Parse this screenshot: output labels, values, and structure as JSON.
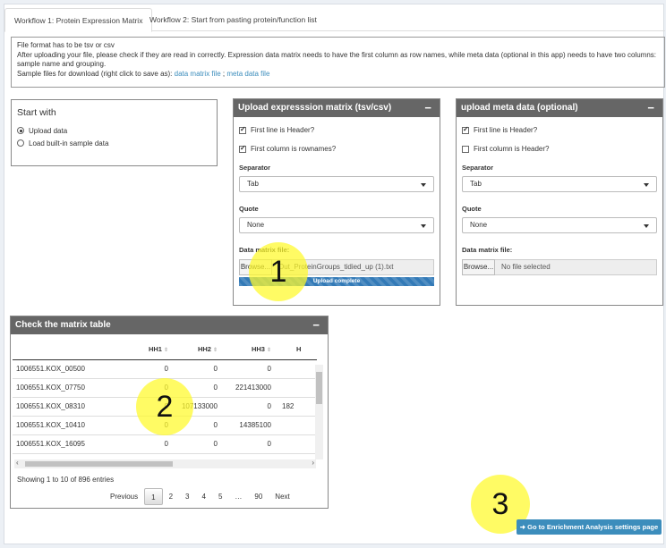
{
  "tabs": [
    "Workflow 1: Protein Expression Matrix",
    "Workflow 2: Start from pasting protein/function list"
  ],
  "info": {
    "line1": "File format has to be tsv or csv",
    "line2": "After uploading your file, please check if they are read in correctly. Expression data matrix needs to have the first column as row names, while meta data (optional in this app) needs to have two columns:",
    "line3": "sample name and grouping.",
    "line4": "Sample files for download (right click to save as):",
    "link1": "data matrix file",
    "sep": ";",
    "link2": "meta data file"
  },
  "start_with": {
    "title": "Start with",
    "options": [
      "Upload data",
      "Load built-in sample data"
    ],
    "selected": 0
  },
  "upload_matrix": {
    "title": "Upload expresssion matrix (tsv/csv)",
    "collapse": "−",
    "first_line_header": {
      "label": "First line is Header?",
      "checked": true
    },
    "first_col_rownames": {
      "label": "First column is rownames?",
      "checked": true
    },
    "separator_label": "Separator",
    "separator_value": "Tab",
    "quote_label": "Quote",
    "quote_value": "None",
    "file_label": "Data matrix file:",
    "browse": "Browse...",
    "file_name": "Out_ProteinGroups_tidied_up (1).txt",
    "progress": "Upload complete",
    "progress_fraction": 1.0
  },
  "upload_meta": {
    "title": "upload meta data (optional)",
    "collapse": "−",
    "first_line_header": {
      "label": "First line is Header?",
      "checked": true
    },
    "first_col_header": {
      "label": "First column is Header?",
      "checked": false
    },
    "separator_label": "Separator",
    "separator_value": "Tab",
    "quote_label": "Quote",
    "quote_value": "None",
    "file_label": "Data matrix file:",
    "browse": "Browse...",
    "file_name": "No file selected"
  },
  "matrix": {
    "title": "Check the matrix table",
    "collapse": "−",
    "columns": [
      "",
      "HH1",
      "HH2",
      "HH3",
      "H"
    ],
    "rows": [
      [
        "1006551.KOX_00500",
        "0",
        "0",
        "0",
        ""
      ],
      [
        "1006551.KOX_07750",
        "0",
        "0",
        "221413000",
        ""
      ],
      [
        "1006551.KOX_08310",
        "0",
        "107133000",
        "0",
        "182"
      ],
      [
        "1006551.KOX_10410",
        "0",
        "0",
        "14385100",
        ""
      ],
      [
        "1006551.KOX_16095",
        "0",
        "0",
        "0",
        ""
      ]
    ],
    "info": "Showing 1 to 10 of 896 entries",
    "pagination": [
      "Previous",
      "1",
      "2",
      "3",
      "4",
      "5",
      "…",
      "90",
      "Next"
    ],
    "current_page": "1"
  },
  "annotations": [
    "1",
    "2",
    "3"
  ],
  "go_button": "Go to Enrichment Analysis settings page",
  "colors": {
    "header": "#666666",
    "accent": "#3c8dbc",
    "highlight": "#fffa28"
  }
}
